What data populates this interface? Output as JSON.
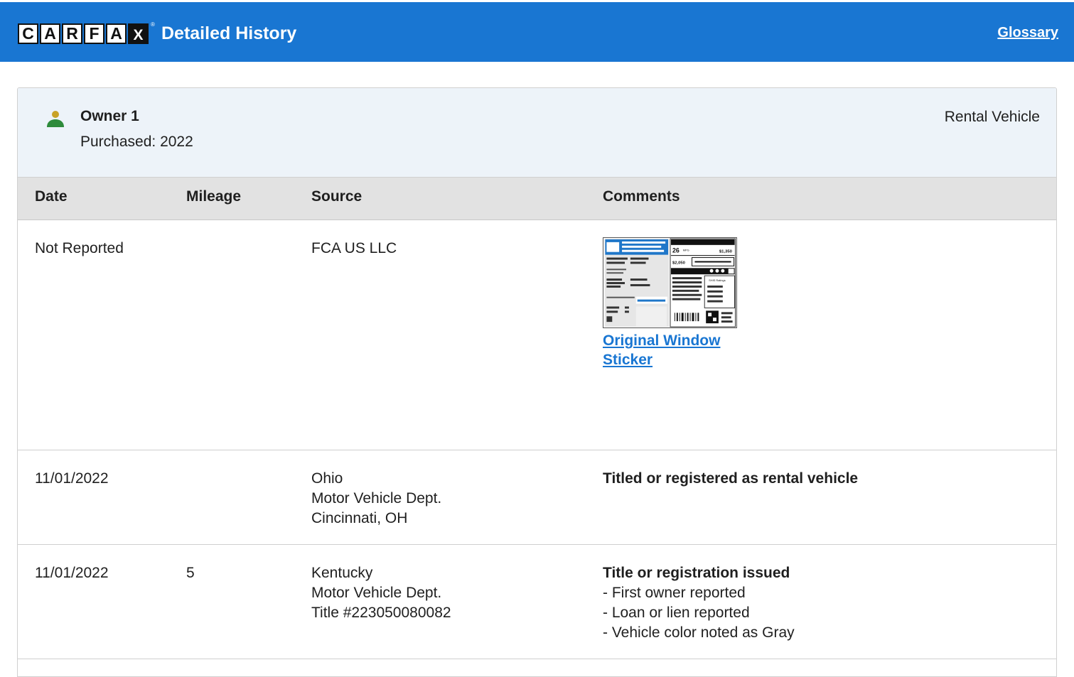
{
  "header": {
    "logo_letters": [
      "C",
      "A",
      "R",
      "F",
      "A",
      "X"
    ],
    "logo_reg": "®",
    "title": "Detailed History",
    "glossary_label": "Glossary"
  },
  "owner": {
    "name": "Owner 1",
    "purchased": "Purchased: 2022",
    "type": "Rental Vehicle",
    "icon": "person-icon",
    "icon_colors": {
      "head": "#c8a227",
      "body": "#2e8b3c"
    }
  },
  "table": {
    "columns": [
      "Date",
      "Mileage",
      "Source",
      "Comments"
    ],
    "rows": [
      {
        "date": "Not Reported",
        "mileage": "",
        "source": [
          "FCA US LLC"
        ],
        "comment_link": "Original Window Sticker"
      },
      {
        "date": "11/01/2022",
        "mileage": "",
        "source": [
          "Ohio",
          "Motor Vehicle Dept.",
          "Cincinnati, OH"
        ],
        "comment_title": "Titled or registered as rental vehicle",
        "comment_items": []
      },
      {
        "date": "11/01/2022",
        "mileage": "5",
        "source": [
          "Kentucky",
          "Motor Vehicle Dept.",
          "Title #223050080082"
        ],
        "comment_title": "Title or registration issued",
        "comment_items": [
          "- First owner reported",
          "- Loan or lien reported",
          "- Vehicle color noted as Gray"
        ]
      }
    ]
  },
  "sticker_text": {
    "mpg": "26",
    "mpg_unit": "MPG",
    "save": "$1,350",
    "cost": "$2,050",
    "ratings": "SHIS Ratings"
  },
  "colors": {
    "brand_blue": "#1976d2",
    "owner_bg": "#edf3f9",
    "header_row_bg": "#e2e2e2"
  }
}
